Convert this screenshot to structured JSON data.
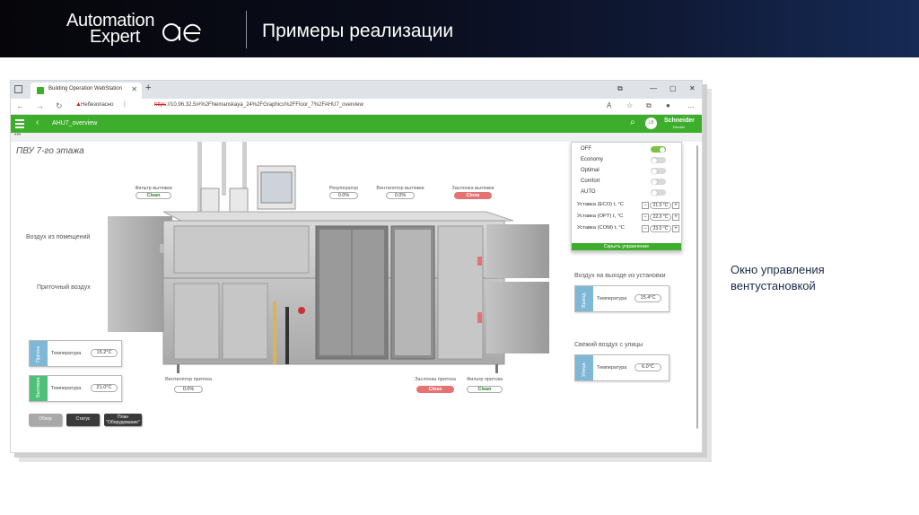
{
  "slide": {
    "logo_line1": "Automation",
    "logo_line2": "Expert",
    "title": "Примеры реализации",
    "caption": "Окно управления вентустановкой"
  },
  "browser": {
    "tab_title": "Building Operation WebStation",
    "insecure_label": "Небезопасно",
    "url_scheme": "https",
    "url_rest": "://10.96.32.5/#%2FNemanskaya_24%2FGraphics%2FFloor_7%2FAHU7_overview"
  },
  "app": {
    "title": "AHU7_overview",
    "user_initials": "LB",
    "brand": "Schneider",
    "brand_sub": "Electric",
    "accent": "#3dae2b"
  },
  "canvas": {
    "heading": "ПВУ 7-го этажа",
    "exhaust_filter": {
      "label": "Фильтр вытяжки",
      "value": "Clean"
    },
    "recuperator": {
      "label": "Рекуператор",
      "value": "0.0%"
    },
    "exhaust_fan": {
      "label": "Вентилятор вытяжки",
      "value": "0.0%"
    },
    "exhaust_damper": {
      "label": "Заслонка вытяжки",
      "value": "Close"
    },
    "room_air": "Воздух из помещений",
    "supply_air": "Приточный воздух",
    "supply_fan": {
      "label": "Вентилятор притока",
      "value": "0.0%"
    },
    "supply_damper": {
      "label": "Заслонка притока",
      "value": "Close"
    },
    "supply_filter": {
      "label": "Фильтр притока",
      "value": "Clean"
    },
    "unit_outlet_title": "Воздух на выходе из установки",
    "outdoor_title": "Свежий воздух с улицы",
    "temp_label": "Температура",
    "cards": {
      "intake": {
        "tag": "Приток",
        "value": "15.2°C",
        "color": "#7fb8d6"
      },
      "exhaust": {
        "tag": "Вытяжка",
        "value": "21.0°C",
        "color": "#4fc07a"
      },
      "outlet": {
        "tag": "Выход",
        "value": "15.4°C",
        "color": "#7fb8d6"
      },
      "street": {
        "tag": "Улица",
        "value": "6.0°C",
        "color": "#7fb8d6"
      }
    },
    "buttons": {
      "overview": "Обзор",
      "status": "Статус",
      "plan_line1": "План",
      "plan_line2": "\"Оборудование\""
    }
  },
  "mode_panel": {
    "modes": [
      {
        "label": "OFF",
        "on": true
      },
      {
        "label": "Economy",
        "on": false
      },
      {
        "label": "Optimal",
        "on": false
      },
      {
        "label": "Comfort",
        "on": false
      },
      {
        "label": "AUTO",
        "on": false
      }
    ],
    "setpoints": [
      {
        "label": "Уставка (ECO) t, °C",
        "value": "21.0 °C"
      },
      {
        "label": "Уставка (OPT) t, °C",
        "value": "22.0 °C"
      },
      {
        "label": "Уставка (COM) t, °C",
        "value": "23.0 °C"
      }
    ],
    "hide_label": "Скрыть управление"
  }
}
